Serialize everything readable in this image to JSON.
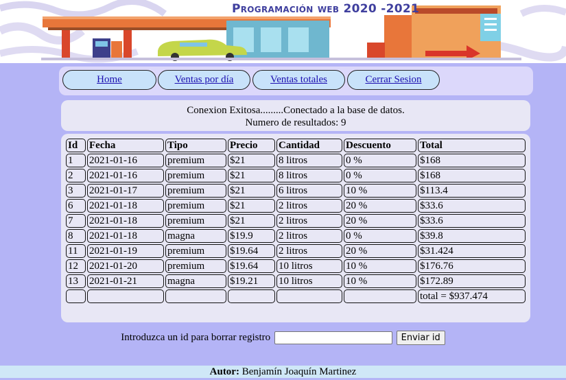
{
  "banner": {
    "title": "Programación web 2020 -2021"
  },
  "nav": [
    {
      "label": "Home"
    },
    {
      "label": "Ventas por día"
    },
    {
      "label": "Ventas totales"
    },
    {
      "label": "Cerrar Sesion"
    }
  ],
  "status": {
    "connection": "Conexion Exitosa.........Conectado a la base de datos.",
    "results": "Numero de resultados: 9"
  },
  "table": {
    "headers": [
      "Id",
      "Fecha",
      "Tipo",
      "Precio",
      "Cantidad",
      "Descuento",
      "Total"
    ],
    "rows": [
      [
        "1",
        "2021-01-16",
        "premium",
        "$21",
        "8 litros",
        "0 %",
        "$168"
      ],
      [
        "2",
        "2021-01-16",
        "premium",
        "$21",
        "8 litros",
        "0 %",
        "$168"
      ],
      [
        "3",
        "2021-01-17",
        "premium",
        "$21",
        "6 litros",
        "10 %",
        "$113.4"
      ],
      [
        "6",
        "2021-01-18",
        "premium",
        "$21",
        "2 litros",
        "20 %",
        "$33.6"
      ],
      [
        "7",
        "2021-01-18",
        "premium",
        "$21",
        "2 litros",
        "20 %",
        "$33.6"
      ],
      [
        "8",
        "2021-01-18",
        "magna",
        "$19.9",
        "2 litros",
        "0 %",
        "$39.8"
      ],
      [
        "11",
        "2021-01-19",
        "premium",
        "$19.64",
        "2 litros",
        "20 %",
        "$31.424"
      ],
      [
        "12",
        "2021-01-20",
        "premium",
        "$19.64",
        "10 litros",
        "10 %",
        "$176.76"
      ],
      [
        "13",
        "2021-01-21",
        "magna",
        "$19.21",
        "10 litros",
        "10 %",
        "$172.89"
      ]
    ],
    "total": "total = $937.474"
  },
  "form": {
    "label": "Introduzca un id para borrar registro",
    "input_value": "",
    "button_label": "Enviar id"
  },
  "footer": {
    "author_label": "Autor:",
    "author_name": "Benjamín Joaquín Martinez"
  }
}
